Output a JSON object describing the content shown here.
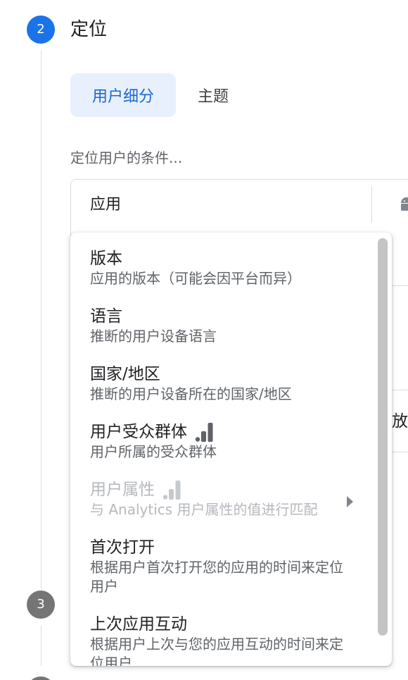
{
  "colors": {
    "accent": "#1a73e8",
    "tab_selected_bg": "#e8f0fe",
    "tab_selected_text": "#1967d2",
    "text_primary": "#202124",
    "text_secondary": "#5f6368",
    "text_disabled": "#b5b8bd",
    "step_inactive": "#757575"
  },
  "stepper": {
    "current_step": {
      "number": "2",
      "title": "定位"
    },
    "next_step": {
      "number": "3"
    }
  },
  "tabs": [
    {
      "label": "用户细分",
      "selected": true
    },
    {
      "label": "主题",
      "selected": false
    }
  ],
  "condition": {
    "label": "定位用户的条件...",
    "field": "应用",
    "platform_icon": "android-icon",
    "partial_text": "放"
  },
  "menu": {
    "items": [
      {
        "title": "版本",
        "subtitle": "应用的版本（可能会因平台而异）"
      },
      {
        "title": "语言",
        "subtitle": "推断的用户设备语言"
      },
      {
        "title": "国家/地区",
        "subtitle": "推断的用户设备所在的国家/地区"
      },
      {
        "title": "用户受众群体",
        "subtitle": "用户所属的受众群体",
        "icon": "signal-bars-icon"
      },
      {
        "title": "用户属性",
        "subtitle": "与 Analytics 用户属性的值进行匹配",
        "icon": "signal-bars-icon",
        "disabled": true,
        "submenu_icon": "arrow-right-icon"
      },
      {
        "title": "首次打开",
        "subtitle": "根据用户首次打开您的应用的时间来定位用户"
      },
      {
        "title": "上次应用互动",
        "subtitle": "根据用户上次与您的应用互动的时间来定位用户"
      }
    ]
  }
}
